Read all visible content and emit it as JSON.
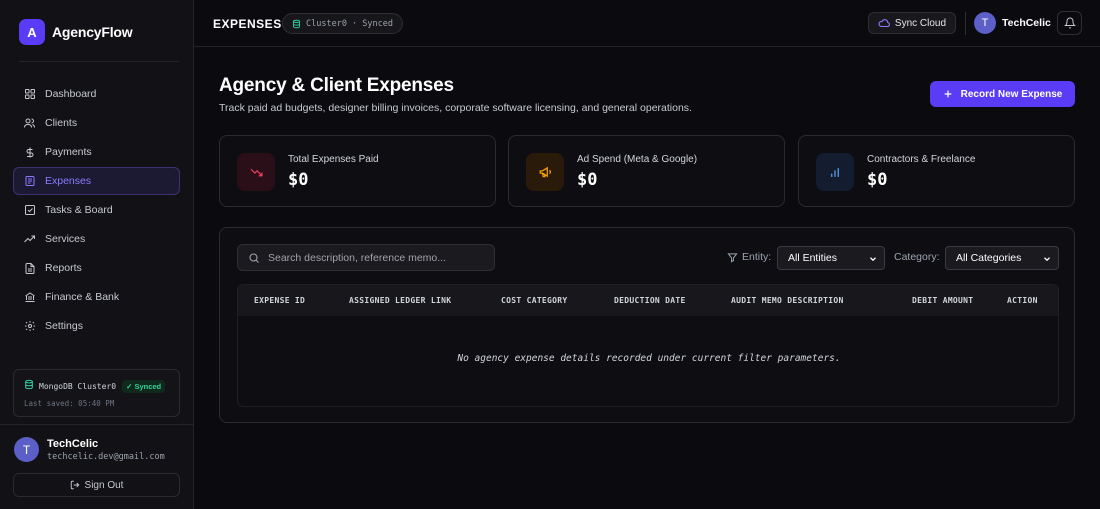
{
  "brand": {
    "logo_letter": "A",
    "name": "AgencyFlow"
  },
  "nav": [
    {
      "label": "Dashboard",
      "icon": "grid-icon",
      "active": false
    },
    {
      "label": "Clients",
      "icon": "users-icon",
      "active": false
    },
    {
      "label": "Payments",
      "icon": "dollar-icon",
      "active": false
    },
    {
      "label": "Expenses",
      "icon": "receipt-icon",
      "active": true
    },
    {
      "label": "Tasks & Board",
      "icon": "check-square-icon",
      "active": false
    },
    {
      "label": "Services",
      "icon": "trending-up-icon",
      "active": false
    },
    {
      "label": "Reports",
      "icon": "file-text-icon",
      "active": false
    },
    {
      "label": "Finance & Bank",
      "icon": "bank-icon",
      "active": false
    },
    {
      "label": "Settings",
      "icon": "gear-icon",
      "active": false
    }
  ],
  "db_status": {
    "name": "MongoDB Cluster0",
    "badge": "Synced",
    "saved": "Last saved: 05:40 PM"
  },
  "user": {
    "initial": "T",
    "name": "TechCelic",
    "email": "techcelic.dev@gmail.com",
    "signout": "Sign Out"
  },
  "topbar": {
    "title": "EXPENSES",
    "cluster": "Cluster0 · Synced",
    "sync_label": "Sync Cloud",
    "user_initial": "T",
    "user_name": "TechCelic"
  },
  "page": {
    "title": "Agency & Client Expenses",
    "subtitle": "Track paid ad budgets, designer billing invoices, corporate software licensing, and general operations.",
    "primary_button": "Record New Expense"
  },
  "stats": [
    {
      "label": "Total Expenses Paid",
      "value": "$0",
      "icon": "trending-down-icon",
      "color": "#f43f5e",
      "bg": "#2a0f18"
    },
    {
      "label": "Ad Spend (Meta & Google)",
      "value": "$0",
      "icon": "megaphone-icon",
      "color": "#f59e0b",
      "bg": "#2a1a0a"
    },
    {
      "label": "Contractors & Freelance",
      "value": "$0",
      "icon": "bar-chart-icon",
      "color": "#60a5fa",
      "bg": "#141c30"
    }
  ],
  "filters": {
    "search_placeholder": "Search description, reference memo...",
    "entity_label": "Entity:",
    "entity_value": "All Entities",
    "category_label": "Category:",
    "category_value": "All Categories"
  },
  "table": {
    "columns": [
      "EXPENSE ID",
      "ASSIGNED LEDGER LINK",
      "COST CATEGORY",
      "DEDUCTION DATE",
      "AUDIT MEMO DESCRIPTION",
      "DEBIT AMOUNT",
      "ACTION"
    ],
    "empty_message": "No agency expense details recorded under current filter parameters."
  },
  "colors": {
    "accent": "#5b3cf6",
    "active_nav_text": "#8b7cff",
    "synced_green": "#34d399"
  }
}
